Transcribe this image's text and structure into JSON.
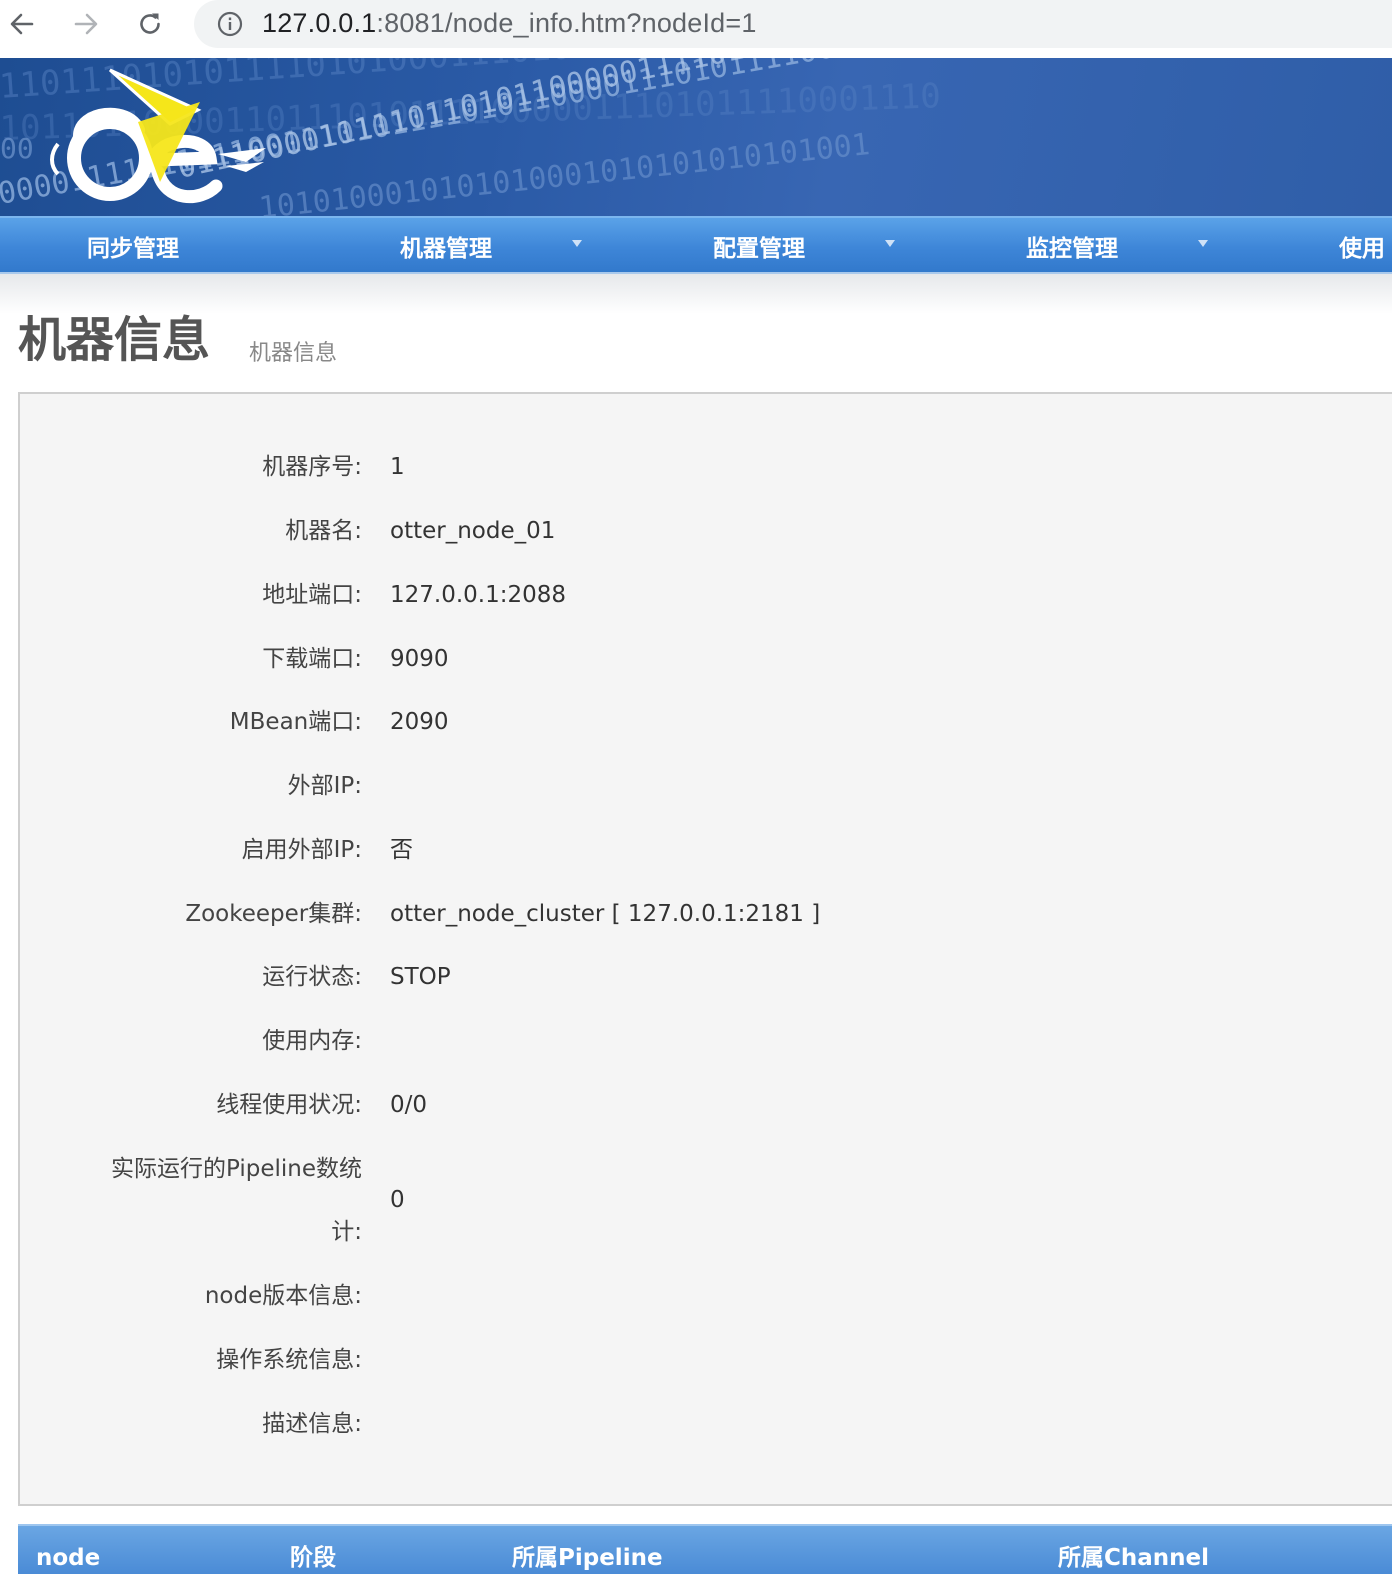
{
  "browser": {
    "url_host": "127.0.0.1",
    "url_path": ":8081/node_info.htm?nodeId=1"
  },
  "menu": {
    "items": [
      {
        "label": "同步管理",
        "dropdown": false
      },
      {
        "label": "机器管理",
        "dropdown": true
      },
      {
        "label": "配置管理",
        "dropdown": true
      },
      {
        "label": "监控管理",
        "dropdown": true
      },
      {
        "label": "使用",
        "dropdown": false
      }
    ]
  },
  "page": {
    "title": "机器信息",
    "subtitle": "机器信息"
  },
  "node_info": {
    "fields": [
      {
        "label": "机器序号:",
        "value": "1"
      },
      {
        "label": "机器名:",
        "value": "otter_node_01"
      },
      {
        "label": "地址端口:",
        "value": "127.0.0.1:2088"
      },
      {
        "label": "下载端口:",
        "value": "9090"
      },
      {
        "label": "MBean端口:",
        "value": "2090"
      },
      {
        "label": "外部IP:",
        "value": ""
      },
      {
        "label": "启用外部IP:",
        "value": "否"
      },
      {
        "label": "Zookeeper集群:",
        "value": "otter_node_cluster [ 127.0.0.1:2181 ]"
      },
      {
        "label": "运行状态:",
        "value": "STOP"
      },
      {
        "label": "使用内存:",
        "value": ""
      },
      {
        "label": "线程使用状况:",
        "value": "0/0"
      },
      {
        "label": "实际运行的Pipeline数统计:",
        "value": "0"
      },
      {
        "label": "node版本信息:",
        "value": ""
      },
      {
        "label": "操作系统信息:",
        "value": ""
      },
      {
        "label": "描述信息:",
        "value": ""
      }
    ]
  },
  "table": {
    "columns": [
      "node",
      "阶段",
      "所属Pipeline",
      "所属Channel"
    ]
  },
  "colors": {
    "menu_blue": "#3e86d8",
    "banner_blue": "#2a5aa6",
    "logo_yellow": "#f5e61a",
    "panel_bg": "#f5f5f5"
  }
}
